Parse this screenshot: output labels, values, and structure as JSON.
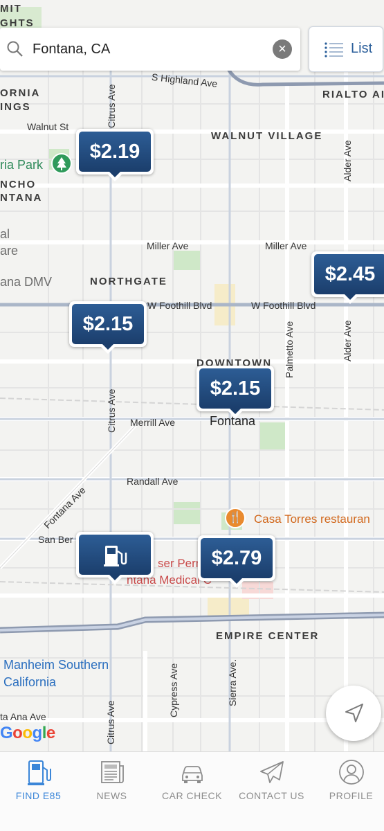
{
  "search": {
    "query": "Fontana, CA"
  },
  "list_button": {
    "label": "List"
  },
  "markers": [
    {
      "price": "$2.19"
    },
    {
      "price": "$2.45"
    },
    {
      "price": "$2.15"
    },
    {
      "price": "$2.15"
    },
    {
      "price": "$2.79"
    }
  ],
  "map": {
    "areas": {
      "mit": "MIT",
      "ghts": "GHTS",
      "ornia": "ORNIA",
      "ings": "INGS",
      "rialto": "RIALTO AI",
      "walnut_village": "WALNUT VILLAGE",
      "ncho": "NCHO",
      "ntana": "NTANA",
      "northgate": "NORTHGATE",
      "downtown": "DOWNTOWN",
      "empire_center": "EMPIRE CENTER"
    },
    "streets": {
      "s_highland": "S Highland Ave",
      "walnut_st": "Walnut St",
      "citrus_top": "Citrus Ave",
      "alder_top": "Alder Ave",
      "miller_1": "Miller Ave",
      "miller_2": "Miller Ave",
      "foothill_1": "W Foothill Blvd",
      "foothill_2": "W Foothill Blvd",
      "palmetto": "Palmetto Ave",
      "alder_mid": "Alder Ave",
      "citrus_mid": "Citrus Ave",
      "merrill": "Merrill Ave",
      "randall": "Randall Ave",
      "fontana_ave": "Fontana Ave",
      "san_ber": "San Ber",
      "cypress": "Cypress Ave",
      "sierra": "Sierra Ave.",
      "citrus_bottom": "Citrus Ave",
      "ta_ana": "ta Ana Ave"
    },
    "places": {
      "ria_park": "ria Park",
      "al": "al",
      "are": "are",
      "ana_dmv": "ana DMV",
      "fontana": "Fontana",
      "casa_torres": "Casa Torres restauran",
      "kaiser_1": "ser Perma",
      "kaiser_2": "ntana Medical C",
      "manheim_1": "Manheim Southern",
      "manheim_2": "California"
    },
    "attribution": "Google",
    "attribution_colors": [
      "#4285f4",
      "#ea4335",
      "#fbbc05",
      "#4285f4",
      "#34a853",
      "#ea4335"
    ]
  },
  "tabs": [
    {
      "label": "FIND E85",
      "icon": "fuel-pump-icon",
      "active": true
    },
    {
      "label": "NEWS",
      "icon": "newspaper-icon",
      "active": false
    },
    {
      "label": "CAR CHECK",
      "icon": "car-icon",
      "active": false
    },
    {
      "label": "CONTACT US",
      "icon": "paper-plane-icon",
      "active": false
    },
    {
      "label": "PROFILE",
      "icon": "profile-icon",
      "active": false
    }
  ],
  "colors": {
    "accent": "#3b86d8",
    "marker": "#1f4676",
    "tab_inactive": "#8c8c8c"
  }
}
